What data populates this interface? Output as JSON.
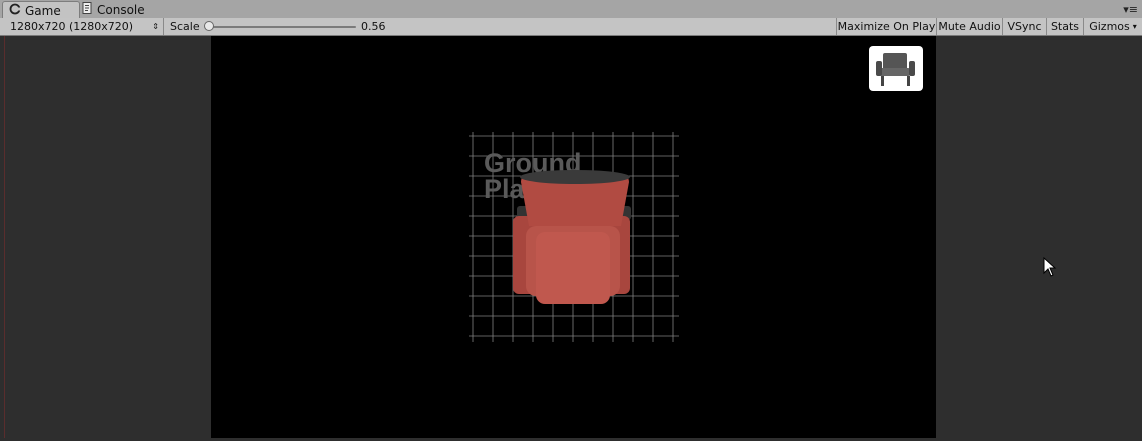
{
  "tabs": [
    {
      "label": "Game",
      "icon": "gamepad-icon"
    },
    {
      "label": "Console",
      "icon": "console-icon"
    }
  ],
  "toolbar": {
    "resolution": "1280x720 (1280x720)",
    "scale_label": "Scale",
    "scale_value": "0.56",
    "maximize_label": "Maximize On Play",
    "mute_label": "Mute Audio",
    "vsync_label": "VSync",
    "stats_label": "Stats",
    "gizmos_label": "Gizmos"
  },
  "scene": {
    "ground_text_line1": "Ground",
    "ground_text_line2": "Plane",
    "chair_color": "#b14b42"
  }
}
